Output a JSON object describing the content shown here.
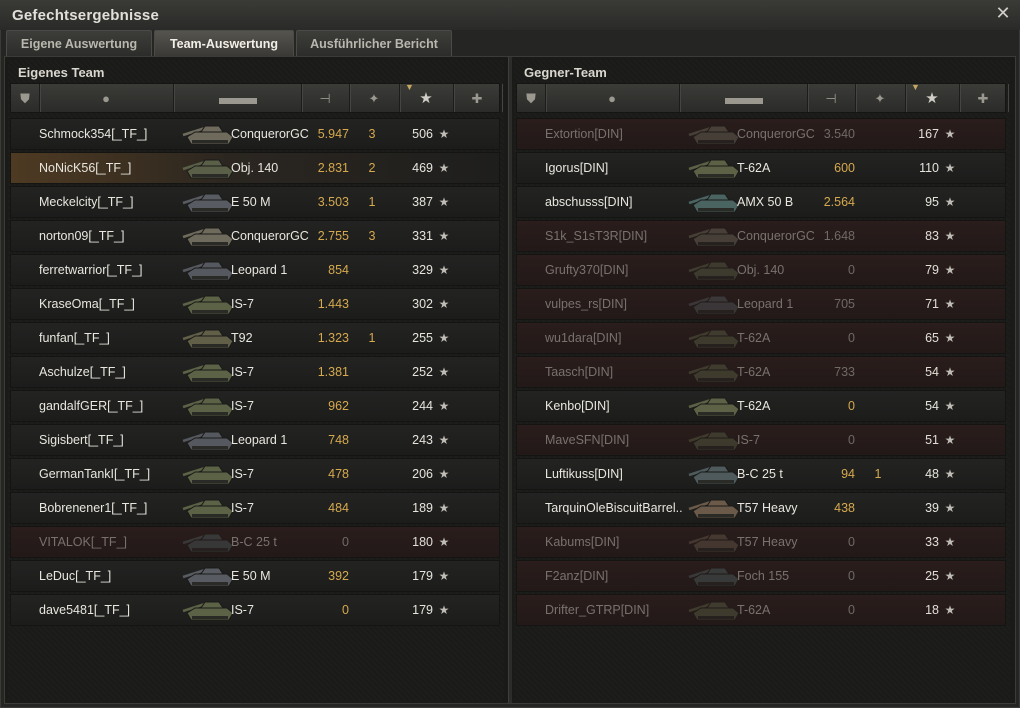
{
  "window": {
    "title": "Gefechtsergebnisse",
    "close_icon": "close-icon"
  },
  "tabs": [
    {
      "label": "Eigene Auswertung",
      "active": false
    },
    {
      "label": "Team-Auswertung",
      "active": true
    },
    {
      "label": "Ausführlicher Bericht",
      "active": false
    }
  ],
  "columns": {
    "icons": [
      "squad-icon",
      "player-icon",
      "tank-icon",
      "damage-icon",
      "kills-icon",
      "xp-star-icon",
      "medal-icon"
    ],
    "sorted_column": "xp"
  },
  "own_team": {
    "title": "Eigenes Team",
    "players": [
      {
        "name": "Schmock354[_TF_]",
        "tank": "ConquerorGC",
        "damage": "5.947",
        "kills": "3",
        "xp": "506",
        "dead": false,
        "me": false,
        "tank_color": "#6e6b5c"
      },
      {
        "name": "NoNicK56[_TF_]",
        "tank": "Obj. 140",
        "damage": "2.831",
        "kills": "2",
        "xp": "469",
        "dead": false,
        "me": true,
        "tank_color": "#5a6048"
      },
      {
        "name": "Meckelcity[_TF_]",
        "tank": "E 50 M",
        "damage": "3.503",
        "kills": "1",
        "xp": "387",
        "dead": false,
        "me": false,
        "tank_color": "#585c62"
      },
      {
        "name": "norton09[_TF_]",
        "tank": "ConquerorGC",
        "damage": "2.755",
        "kills": "3",
        "xp": "331",
        "dead": false,
        "me": false,
        "tank_color": "#6e6b5c"
      },
      {
        "name": "ferretwarrior[_TF_]",
        "tank": "Leopard 1",
        "damage": "854",
        "kills": "",
        "xp": "329",
        "dead": false,
        "me": false,
        "tank_color": "#55585e"
      },
      {
        "name": "KraseOma[_TF_]",
        "tank": "IS-7",
        "damage": "1.443",
        "kills": "",
        "xp": "302",
        "dead": false,
        "me": false,
        "tank_color": "#5b6246"
      },
      {
        "name": "funfan[_TF_]",
        "tank": "T92",
        "damage": "1.323",
        "kills": "1",
        "xp": "255",
        "dead": false,
        "me": false,
        "tank_color": "#625f48"
      },
      {
        "name": "Aschulze[_TF_]",
        "tank": "IS-7",
        "damage": "1.381",
        "kills": "",
        "xp": "252",
        "dead": false,
        "me": false,
        "tank_color": "#5b6246"
      },
      {
        "name": "gandalfGER[_TF_]",
        "tank": "IS-7",
        "damage": "962",
        "kills": "",
        "xp": "244",
        "dead": false,
        "me": false,
        "tank_color": "#5b6246"
      },
      {
        "name": "Sigisbert[_TF_]",
        "tank": "Leopard 1",
        "damage": "748",
        "kills": "",
        "xp": "243",
        "dead": false,
        "me": false,
        "tank_color": "#55585e"
      },
      {
        "name": "GermanTankI[_TF_]",
        "tank": "IS-7",
        "damage": "478",
        "kills": "",
        "xp": "206",
        "dead": false,
        "me": false,
        "tank_color": "#5b6246"
      },
      {
        "name": "Bobrenener1[_TF_]",
        "tank": "IS-7",
        "damage": "484",
        "kills": "",
        "xp": "189",
        "dead": false,
        "me": false,
        "tank_color": "#5b6246"
      },
      {
        "name": "VITALOK[_TF_]",
        "tank": "B-C 25 t",
        "damage": "0",
        "kills": "",
        "xp": "180",
        "dead": true,
        "me": false,
        "tank_color": "#4f5a5c"
      },
      {
        "name": "LeDuc[_TF_]",
        "tank": "E 50 M",
        "damage": "392",
        "kills": "",
        "xp": "179",
        "dead": false,
        "me": false,
        "tank_color": "#585c62"
      },
      {
        "name": "dave5481[_TF_]",
        "tank": "IS-7",
        "damage": "0",
        "kills": "",
        "xp": "179",
        "dead": false,
        "me": false,
        "tank_color": "#5b6246"
      }
    ]
  },
  "enemy_team": {
    "title": "Gegner-Team",
    "players": [
      {
        "name": "Extortion[DIN]",
        "tank": "ConquerorGC",
        "damage": "3.540",
        "kills": "",
        "xp": "167",
        "dead": true,
        "me": false,
        "tank_color": "#6e6b5c"
      },
      {
        "name": "Igorus[DIN]",
        "tank": "T-62A",
        "damage": "600",
        "kills": "",
        "xp": "110",
        "dead": false,
        "me": false,
        "tank_color": "#5d6246"
      },
      {
        "name": "abschusss[DIN]",
        "tank": "AMX 50 B",
        "damage": "2.564",
        "kills": "",
        "xp": "95",
        "dead": false,
        "me": false,
        "tank_color": "#4a6462"
      },
      {
        "name": "S1k_S1sT3R[DIN]",
        "tank": "ConquerorGC",
        "damage": "1.648",
        "kills": "",
        "xp": "83",
        "dead": true,
        "me": false,
        "tank_color": "#6e6b5c"
      },
      {
        "name": "Grufty370[DIN]",
        "tank": "Obj. 140",
        "damage": "0",
        "kills": "",
        "xp": "79",
        "dead": true,
        "me": false,
        "tank_color": "#5a6048"
      },
      {
        "name": "vulpes_rs[DIN]",
        "tank": "Leopard 1",
        "damage": "705",
        "kills": "",
        "xp": "71",
        "dead": true,
        "me": false,
        "tank_color": "#55585e"
      },
      {
        "name": "wu1dara[DIN]",
        "tank": "T-62A",
        "damage": "0",
        "kills": "",
        "xp": "65",
        "dead": true,
        "me": false,
        "tank_color": "#5d6246"
      },
      {
        "name": "Taasch[DIN]",
        "tank": "T-62A",
        "damage": "733",
        "kills": "",
        "xp": "54",
        "dead": true,
        "me": false,
        "tank_color": "#5d6246"
      },
      {
        "name": "Kenbo[DIN]",
        "tank": "T-62A",
        "damage": "0",
        "kills": "",
        "xp": "54",
        "dead": false,
        "me": false,
        "tank_color": "#5d6246"
      },
      {
        "name": "MaveSFN[DIN]",
        "tank": "IS-7",
        "damage": "0",
        "kills": "",
        "xp": "51",
        "dead": true,
        "me": false,
        "tank_color": "#5b6246"
      },
      {
        "name": "Luftikuss[DIN]",
        "tank": "B-C 25 t",
        "damage": "94",
        "kills": "1",
        "xp": "48",
        "dead": false,
        "me": false,
        "tank_color": "#4f5a5c"
      },
      {
        "name": "TarquinOleBiscuitBarrel..",
        "tank": "T57 Heavy",
        "damage": "438",
        "kills": "",
        "xp": "39",
        "dead": false,
        "me": false,
        "tank_color": "#6b5a4a"
      },
      {
        "name": "Kabums[DIN]",
        "tank": "T57 Heavy",
        "damage": "0",
        "kills": "",
        "xp": "33",
        "dead": true,
        "me": false,
        "tank_color": "#6b5a4a"
      },
      {
        "name": "F2anz[DIN]",
        "tank": "Foch 155",
        "damage": "0",
        "kills": "",
        "xp": "25",
        "dead": true,
        "me": false,
        "tank_color": "#4f5f60"
      },
      {
        "name": "Drifter_GTRP[DIN]",
        "tank": "T-62A",
        "damage": "0",
        "kills": "",
        "xp": "18",
        "dead": true,
        "me": false,
        "tank_color": "#5d6246"
      }
    ]
  }
}
